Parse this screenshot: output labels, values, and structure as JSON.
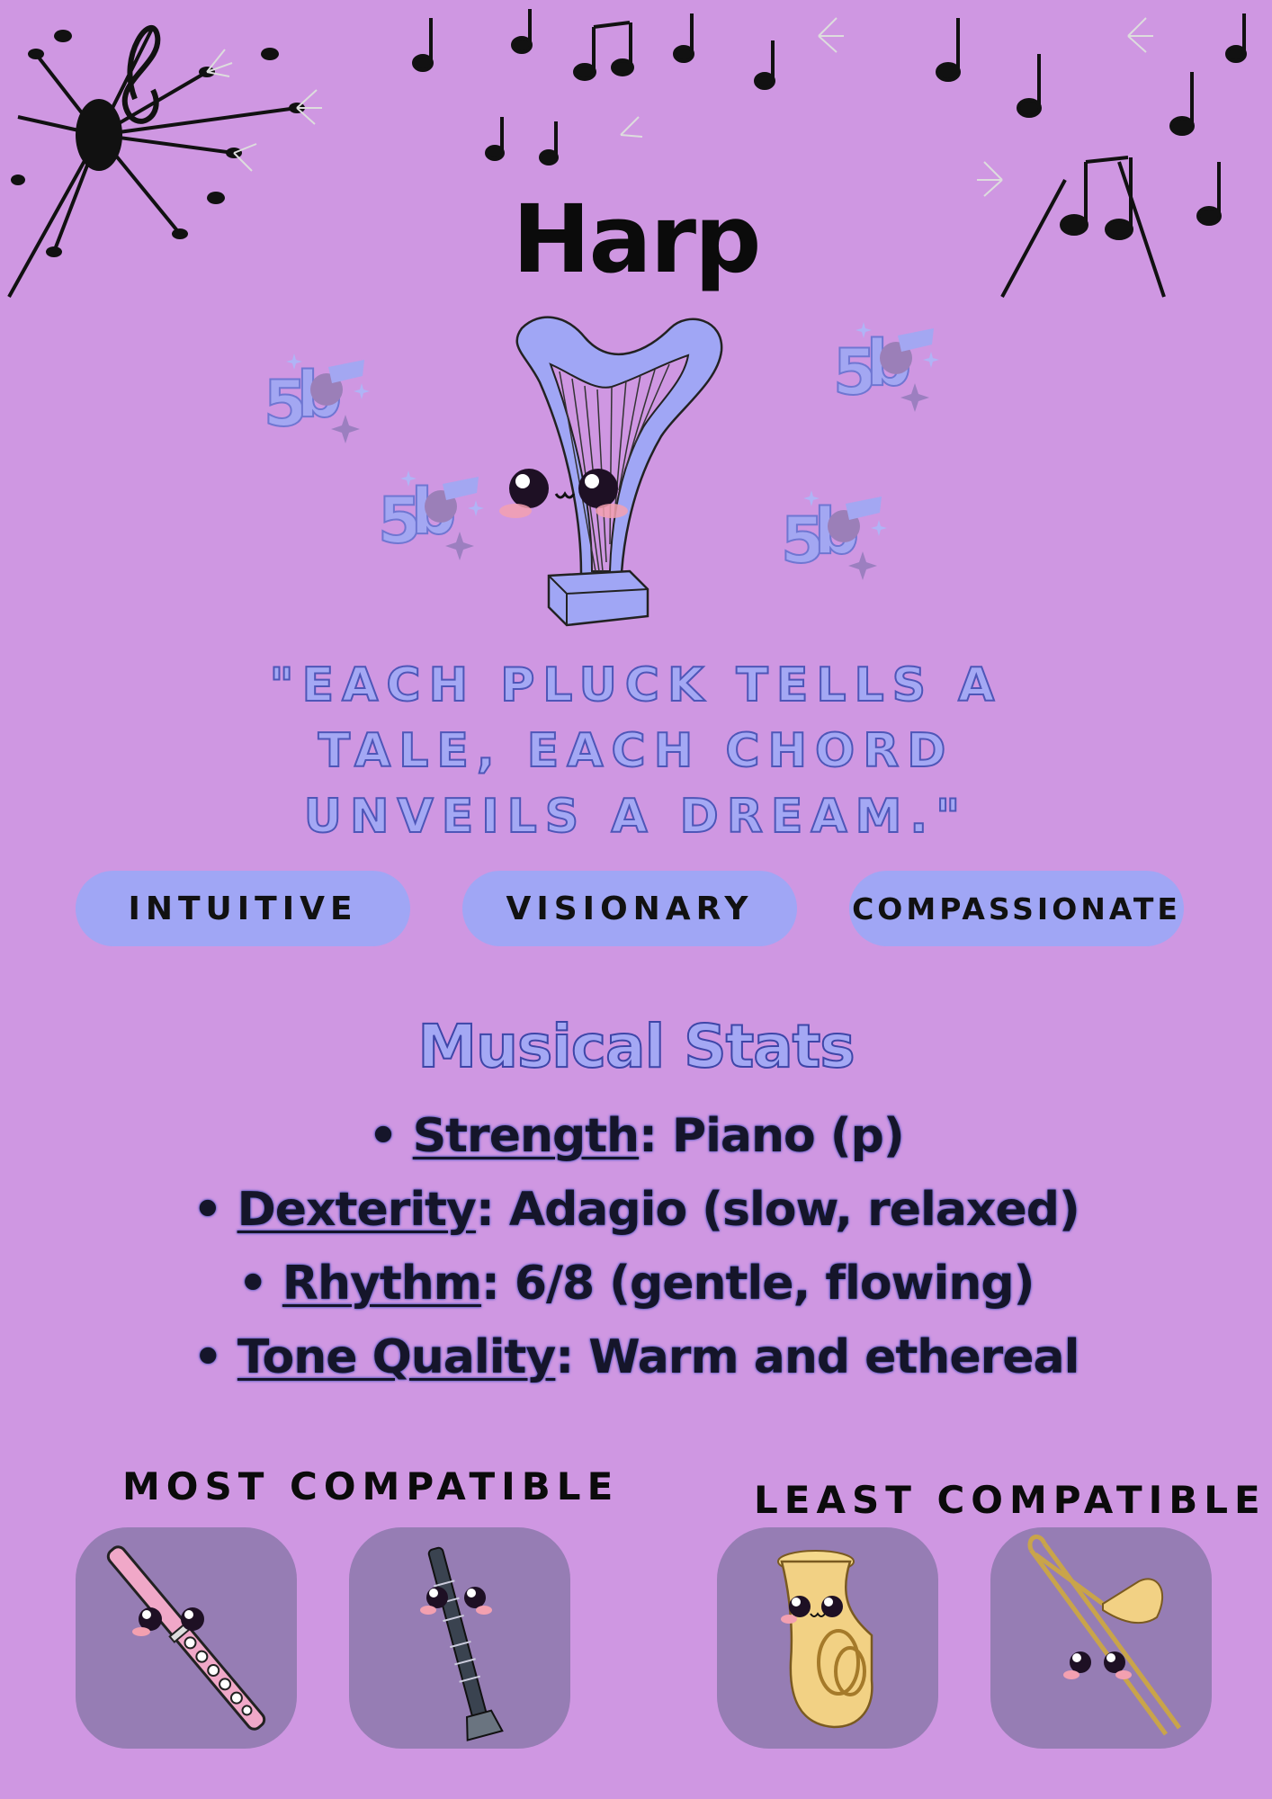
{
  "title": "Harp",
  "quote": "\"Each pluck tells a tale, each chord unveils a dream.\"",
  "traits": [
    "INTUITIVE",
    "VISIONARY",
    "COMPASSIONATE"
  ],
  "stats_heading": "Musical Stats",
  "stats": [
    {
      "label": "Strength",
      "value": ": Piano (p)"
    },
    {
      "label": "Dexterity",
      "value": ": Adagio (slow, relaxed)"
    },
    {
      "label": "Rhythm",
      "value": ": 6/8 (gentle, flowing)"
    },
    {
      "label": "Tone Quality",
      "value": ": Warm and ethereal"
    }
  ],
  "most_compatible": {
    "label": "MOST COMPATIBLE",
    "items": [
      {
        "icon": "flute-icon"
      },
      {
        "icon": "clarinet-icon"
      }
    ]
  },
  "least_compatible": {
    "label": "LEAST COMPATIBLE",
    "items": [
      {
        "icon": "tuba-icon"
      },
      {
        "icon": "trombone-icon"
      }
    ]
  },
  "colors": {
    "background": "#cf97e2",
    "accent": "#a0a6f5",
    "card": "#967db4",
    "text": "#0b0b0b"
  }
}
